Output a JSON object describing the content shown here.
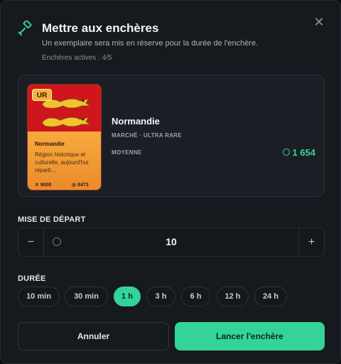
{
  "header": {
    "title": "Mettre aux enchères",
    "subtitle": "Un exemplaire sera mis en réserve pour la durée de l'enchère.",
    "active_auctions": "Enchères actives : 4/5",
    "close_icon": "close-icon",
    "header_icon": "gavel-icon"
  },
  "card": {
    "rarity": "UR",
    "name": "Normandie",
    "description": "Région historique et culturelle, aujourd'hui réparti…",
    "stat_1": "9000",
    "stat_2": "8473",
    "flag_colors": {
      "field": "#d0151d",
      "lion": "#f2c230"
    }
  },
  "item": {
    "name": "Normandie",
    "category": "MARCHÉ · ULTRA RARE",
    "level": "MOYENNE",
    "price": "1 654"
  },
  "bid": {
    "label": "MISE DE DÉPART",
    "minus": "−",
    "plus": "+",
    "value": "10"
  },
  "duration": {
    "label": "DURÉE",
    "options": [
      "10 min",
      "30 min",
      "1 h",
      "3 h",
      "6 h",
      "12 h",
      "24 h"
    ],
    "selected": "1 h"
  },
  "buttons": {
    "cancel": "Annuler",
    "confirm": "Lancer l'enchère"
  },
  "colors": {
    "accent": "#34d399",
    "background": "#16191e"
  }
}
